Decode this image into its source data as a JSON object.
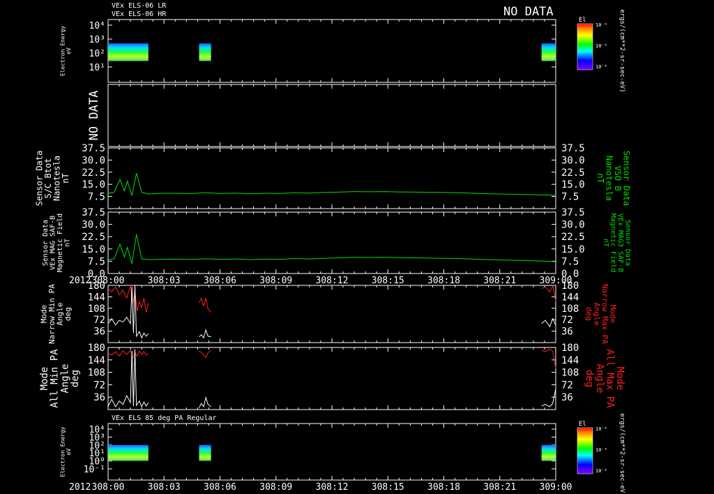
{
  "header": {
    "line1": "VEx ELS-06 LR",
    "line2": "VEx ELS-06 HR",
    "no_data": "NO DATA"
  },
  "colors": {
    "background": "#000000",
    "frame": "#ffffff",
    "green": "#00e000",
    "red": "#ff2020",
    "white": "#ffffff"
  },
  "chart_data": [
    {
      "type": "heatmap",
      "id": "panel1",
      "ylabel": [
        "Electron Energy",
        "eV"
      ],
      "yticks": [
        "10⁴",
        "10³",
        "10²",
        "10¹"
      ],
      "colorbar": {
        "title": "El",
        "ticks": [
          "10⁻⁴",
          "10⁻⁶",
          "10⁻⁸"
        ],
        "unit": "ergs/(cm**2-sr-sec-eV)"
      },
      "x_range": [
        "308:00",
        "309:00"
      ],
      "data_blocks": [
        {
          "start_min": 0.0,
          "end_min": 5.4,
          "energy_range": [
            "10¹",
            "10²"
          ]
        },
        {
          "start_min": 12.2,
          "end_min": 13.8,
          "energy_range": [
            "10¹",
            "10²"
          ]
        },
        {
          "start_min": 58.1,
          "end_min": 60.0,
          "energy_range": [
            "10¹",
            "10²"
          ]
        }
      ]
    },
    {
      "type": "line",
      "id": "panel2",
      "label": "NO DATA"
    },
    {
      "type": "line",
      "id": "panel3",
      "ylabel_left": [
        "Sensor Data",
        "S/C Btot",
        "Nanotesla",
        "nT"
      ],
      "ylabel_right": [
        "Sensor Data",
        "VSO B",
        "Nanotesla",
        "nT"
      ],
      "yticks_left": [
        "37.5",
        "30.0",
        "22.5",
        "15.0",
        "7.5"
      ],
      "yticks_right": [
        "37.5",
        "30.0",
        "22.5",
        "15.0",
        "7.5"
      ],
      "ylim": [
        0,
        37.5
      ],
      "x_range_min": [
        0,
        60
      ],
      "series": [
        {
          "color": "#00e000",
          "x": [
            0,
            0.8,
            1.6,
            2.2,
            2.6,
            3.2,
            3.8,
            4.5,
            5.5,
            7,
            9,
            11,
            13,
            15,
            17,
            19,
            21,
            23,
            25,
            27,
            29,
            31,
            33,
            35,
            37,
            39,
            41,
            43,
            45,
            47,
            49,
            51,
            53,
            55,
            57,
            59,
            60
          ],
          "y": [
            9.5,
            10,
            18,
            11,
            17,
            8,
            22,
            10,
            9,
            9.5,
            9.5,
            9.3,
            9.8,
            9.4,
            9.6,
            9.2,
            9.5,
            9.4,
            9.8,
            9.6,
            10,
            10.2,
            10.5,
            10.4,
            10.5,
            10.3,
            10.2,
            10.1,
            10,
            9.8,
            9.5,
            9.2,
            9,
            8.8,
            8.6,
            8.4,
            8.2
          ]
        }
      ]
    },
    {
      "type": "line",
      "id": "panel4",
      "ylabel_left": [
        "Sensor Data",
        "VEx MAG SAF-B",
        "Magnetic Field",
        "nT"
      ],
      "ylabel_right": [
        "Sensor Data",
        "VEx MAG3 SAF-B",
        "Magnetic Field",
        "nT"
      ],
      "yticks_left": [
        "37.5",
        "30.0",
        "22.5",
        "15.0",
        "7.5",
        "0.0"
      ],
      "yticks_right": [
        "37.5",
        "30.0",
        "22.5",
        "15.0",
        "7.5",
        "0.0"
      ],
      "ylim": [
        0,
        37.5
      ],
      "x_range_min": [
        0,
        60
      ],
      "series": [
        {
          "color": "#00e000",
          "x": [
            0,
            0.8,
            1.6,
            2.2,
            2.6,
            3.2,
            3.8,
            4.5,
            5.5,
            7,
            9,
            11,
            13,
            15,
            17,
            19,
            21,
            23,
            25,
            27,
            29,
            31,
            33,
            35,
            37,
            39,
            41,
            43,
            45,
            47,
            49,
            51,
            53,
            55,
            57,
            59,
            60
          ],
          "y": [
            8.5,
            9,
            18,
            10,
            16,
            6,
            24,
            9,
            8.5,
            8.7,
            8.8,
            8.6,
            9,
            8.7,
            8.9,
            8.5,
            8.8,
            8.7,
            9.1,
            8.9,
            9.3,
            9.6,
            9.9,
            9.8,
            9.9,
            9.7,
            9.6,
            9.4,
            9.3,
            9.1,
            8.8,
            8.5,
            8.2,
            8,
            7.8,
            7.5,
            7.2
          ]
        }
      ]
    },
    {
      "type": "line",
      "id": "panel5",
      "ylabel_left": [
        "Mode",
        "Narrow Min PA",
        "Angle",
        "deg"
      ],
      "ylabel_right": [
        "Mode",
        "Narrow Max PA",
        "Angle",
        "deg"
      ],
      "yticks": [
        "180",
        "144",
        "108",
        "72",
        "36"
      ],
      "ylim": [
        0,
        180
      ],
      "series": [
        {
          "name": "Max PA",
          "color": "#ff2020",
          "segments": [
            {
              "x": [
                0,
                0.5,
                1,
                1.5,
                2,
                2.5,
                3,
                3.3,
                3.6,
                3.9,
                4.2,
                4.5,
                4.8,
                5.1,
                5.4
              ],
              "y": [
                170,
                160,
                175,
                150,
                165,
                140,
                180,
                120,
                160,
                100,
                130,
                110,
                140,
                95,
                125
              ]
            },
            {
              "x": [
                12.2,
                12.5,
                12.8,
                13.1,
                13.4,
                13.8
              ],
              "y": [
                125,
                140,
                115,
                140,
                105,
                95
              ]
            },
            {
              "x": [
                58.1,
                58.6,
                59.2,
                59.6,
                60
              ],
              "y": [
                170,
                175,
                160,
                178,
                130
              ]
            }
          ]
        },
        {
          "name": "Min PA",
          "color": "#ffffff",
          "segments": [
            {
              "x": [
                0,
                0.5,
                1,
                1.5,
                2,
                2.5,
                3,
                3.2,
                3.4,
                3.6,
                3.8,
                4.2,
                4.5,
                4.8,
                5.1,
                5.4
              ],
              "y": [
                60,
                75,
                55,
                70,
                65,
                80,
                60,
                175,
                30,
                180,
                20,
                35,
                15,
                30,
                20,
                28
              ]
            },
            {
              "x": [
                12.2,
                12.5,
                12.8,
                13.1,
                13.4,
                13.8
              ],
              "y": [
                18,
                25,
                15,
                40,
                20,
                18
              ]
            },
            {
              "x": [
                58.1,
                58.6,
                59.2,
                59.6,
                60
              ],
              "y": [
                60,
                70,
                50,
                75,
                55
              ]
            }
          ]
        }
      ]
    },
    {
      "type": "line",
      "id": "panel6",
      "ylabel_left": [
        "Mode",
        "All Min PA",
        "Angle",
        "deg"
      ],
      "ylabel_right": [
        "Mode",
        "All Max PA",
        "Angle",
        "deg"
      ],
      "yticks": [
        "180",
        "144",
        "108",
        "72",
        "36"
      ],
      "ylim": [
        0,
        180
      ],
      "series": [
        {
          "name": "Max PA",
          "color": "#ff2020",
          "segments": [
            {
              "x": [
                0,
                0.5,
                1,
                1.5,
                2,
                2.5,
                3,
                3.3,
                3.6,
                3.9,
                4.2,
                4.5,
                4.8,
                5.1,
                5.4
              ],
              "y": [
                165,
                158,
                168,
                155,
                170,
                160,
                172,
                150,
                165,
                155,
                170,
                160,
                168,
                158,
                162
              ]
            },
            {
              "x": [
                12.2,
                12.5,
                12.8,
                13.1,
                13.4,
                13.8
              ],
              "y": [
                170,
                165,
                158,
                150,
                165,
                172
              ]
            },
            {
              "x": [
                58.1,
                58.6,
                59.2,
                59.6,
                60
              ],
              "y": [
                172,
                168,
                175,
                170,
                120
              ]
            }
          ]
        },
        {
          "name": "Min PA",
          "color": "#ffffff",
          "segments": [
            {
              "x": [
                0,
                0.5,
                1,
                1.5,
                2,
                2.5,
                3,
                3.2,
                3.4,
                3.6,
                3.8,
                4.2,
                4.5,
                4.8,
                5.1,
                5.4
              ],
              "y": [
                10,
                30,
                8,
                25,
                15,
                40,
                20,
                170,
                10,
                175,
                12,
                25,
                8,
                22,
                10,
                20
              ]
            },
            {
              "x": [
                12.2,
                12.5,
                12.8,
                13.1,
                13.4,
                13.8
              ],
              "y": [
                5,
                18,
                8,
                35,
                15,
                8
              ]
            },
            {
              "x": [
                58.1,
                58.6,
                59.2,
                59.6,
                60
              ],
              "y": [
                10,
                15,
                8,
                18,
                60
              ]
            }
          ]
        }
      ]
    },
    {
      "type": "heatmap",
      "id": "panel7",
      "title": "VEx ELS 85 deg PA Regular",
      "ylabel": [
        "Electron Energy",
        "eV"
      ],
      "yticks": [
        "10⁴",
        "10³",
        "10²",
        "10¹",
        "10⁰",
        "10⁻¹"
      ],
      "colorbar": {
        "title": "El",
        "ticks": [
          "10⁻⁴",
          "10⁻⁶",
          "10⁻⁸"
        ],
        "unit": "ergs/(cm**2-sr-sec-eV)"
      },
      "data_blocks": [
        {
          "start_min": 0.0,
          "end_min": 5.4
        },
        {
          "start_min": 12.2,
          "end_min": 13.8
        },
        {
          "start_min": 58.1,
          "end_min": 60.0
        }
      ]
    }
  ],
  "xaxis": {
    "year": "2012",
    "ticks": [
      "308:00",
      "308:03",
      "308:06",
      "308:09",
      "308:12",
      "308:15",
      "308:18",
      "308:21",
      "309:00"
    ],
    "tick_minutes": [
      0,
      7.5,
      15,
      22.5,
      30,
      37.5,
      45,
      52.5,
      60
    ]
  }
}
